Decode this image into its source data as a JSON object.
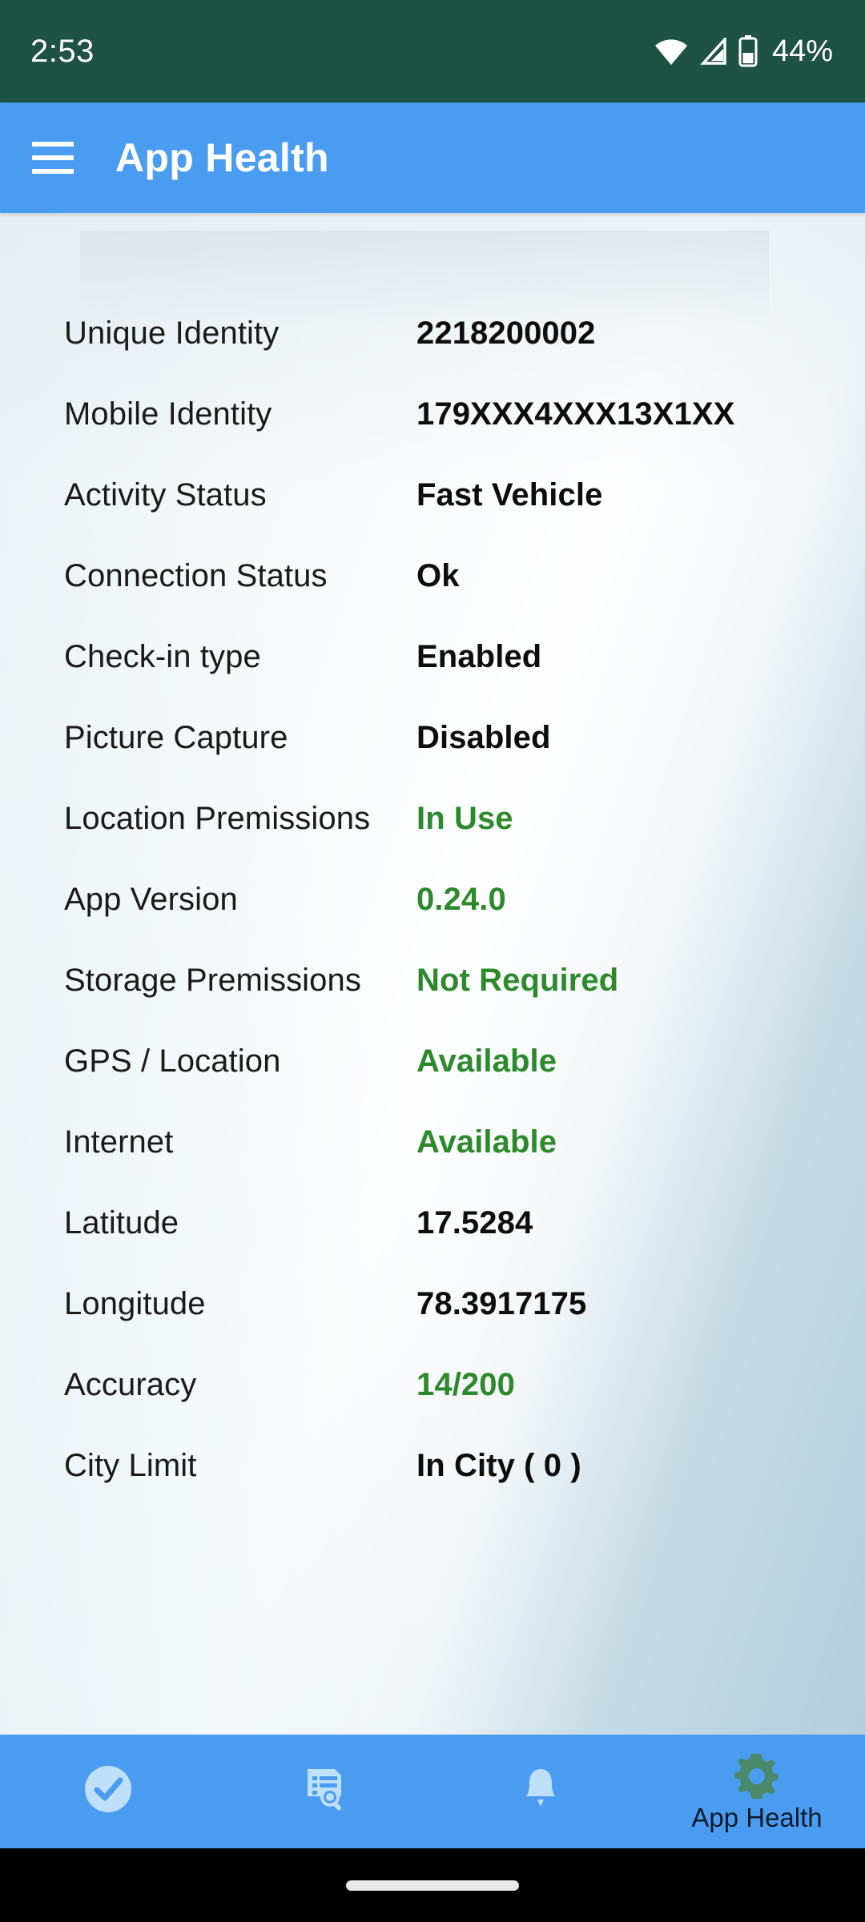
{
  "status_bar": {
    "time": "2:53",
    "battery_percent": "44%",
    "icons": [
      "wifi-icon",
      "cellular-signal-icon",
      "battery-icon"
    ],
    "background_color": "#1e5245"
  },
  "app_bar": {
    "menu_icon": "hamburger-menu-icon",
    "title": "App Health",
    "background_color": "#4a9cf0"
  },
  "colors": {
    "accent_blue": "#4a9cf0",
    "status_green": "#2c8a2c",
    "value_black": "#0d0d0d",
    "gear_green": "#4a8a6a"
  },
  "info_rows": [
    {
      "label": "Unique Identity",
      "value": "2218200002",
      "tone": "dark"
    },
    {
      "label": "Mobile Identity",
      "value": "179XXX4XXX13X1XX",
      "tone": "dark"
    },
    {
      "label": "Activity Status",
      "value": "Fast Vehicle",
      "tone": "dark"
    },
    {
      "label": "Connection Status",
      "value": "Ok",
      "tone": "dark"
    },
    {
      "label": "Check-in type",
      "value": "Enabled",
      "tone": "dark"
    },
    {
      "label": "Picture Capture",
      "value": "Disabled",
      "tone": "dark"
    },
    {
      "label": "Location Premissions",
      "value": "In Use",
      "tone": "green"
    },
    {
      "label": "App Version",
      "value": "0.24.0",
      "tone": "green"
    },
    {
      "label": "Storage Premissions",
      "value": "Not Required",
      "tone": "green"
    },
    {
      "label": "GPS / Location",
      "value": "Available",
      "tone": "green"
    },
    {
      "label": "Internet",
      "value": "Available",
      "tone": "green"
    },
    {
      "label": "Latitude",
      "value": "17.5284",
      "tone": "dark"
    },
    {
      "label": "Longitude",
      "value": "78.3917175",
      "tone": "dark"
    },
    {
      "label": "Accuracy",
      "value": "14/200",
      "tone": "green"
    },
    {
      "label": "City Limit",
      "value": "In City ( 0 )",
      "tone": "dark"
    }
  ],
  "bottom_nav": {
    "items": [
      {
        "icon": "check-circle-icon",
        "label": "",
        "active": false
      },
      {
        "icon": "document-search-icon",
        "label": "",
        "active": false
      },
      {
        "icon": "bell-icon",
        "label": "",
        "active": false
      },
      {
        "icon": "gear-icon",
        "label": "App Health",
        "active": true
      }
    ]
  }
}
